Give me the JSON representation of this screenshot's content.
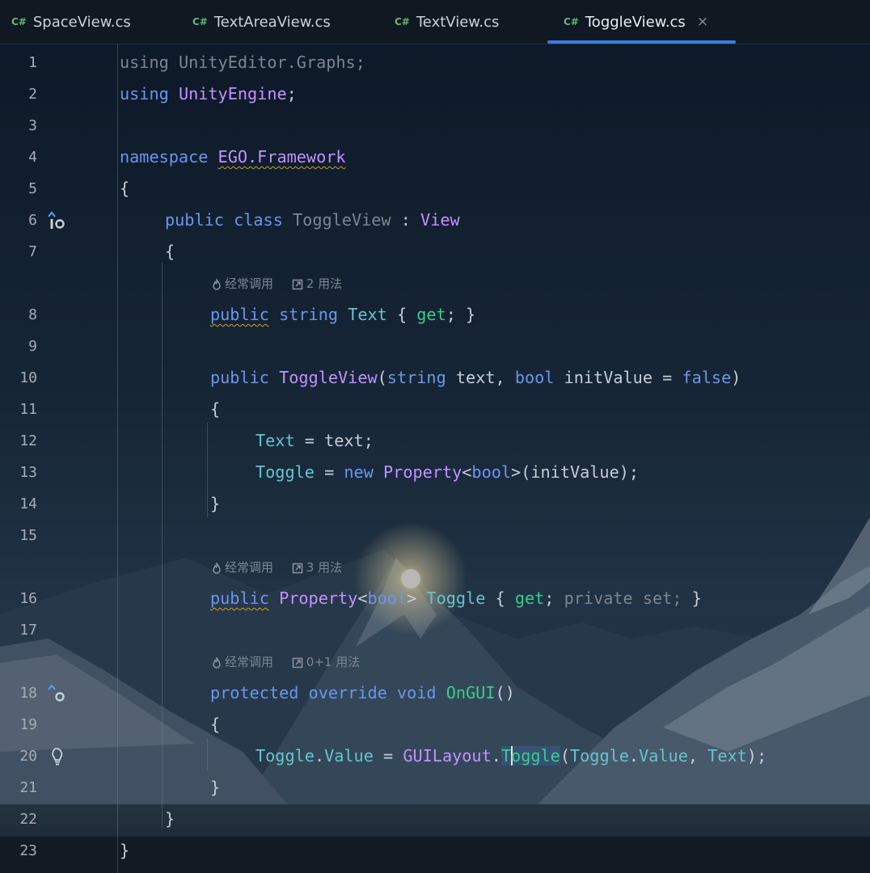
{
  "tabs": [
    {
      "lang": "C#",
      "label": "SpaceView.cs"
    },
    {
      "lang": "C#",
      "label": "TextAreaView.cs"
    },
    {
      "lang": "C#",
      "label": "TextView.cs"
    },
    {
      "lang": "C#",
      "label": "ToggleView.cs",
      "close": "×"
    }
  ],
  "active_tab_index": 3,
  "colors": {
    "keyword": "#6c95eb",
    "type": "#c191ff",
    "property": "#66c3cc",
    "method_accessor": "#39cc8f",
    "dimmed": "#7d858f",
    "accent": "#3b7be6",
    "tab_icon": "#5fb87a"
  },
  "editor": {
    "line_numbers": [
      "1",
      "2",
      "3",
      "4",
      "5",
      "6",
      "7",
      "8",
      "9",
      "10",
      "11",
      "12",
      "13",
      "14",
      "15",
      "16",
      "17",
      "18",
      "19",
      "20",
      "21",
      "22",
      "23"
    ],
    "hints": {
      "h8": {
        "frequent": "经常调用",
        "usages": "2 用法"
      },
      "h16": {
        "frequent": "经常调用",
        "usages": "3 用法"
      },
      "h18": {
        "frequent": "经常调用",
        "usages": "0+1 用法"
      }
    },
    "gutter_icons": {
      "6": "implemented-up-icon",
      "18": "override-up-icon",
      "20": "lightbulb-icon"
    },
    "lines": {
      "l1": {
        "kw": "using",
        "ns": "UnityEditor.Graphs",
        "end": ";"
      },
      "l2": {
        "kw": "using",
        "ns": "UnityEngine",
        "end": ";"
      },
      "l4": {
        "kw": "namespace",
        "ns": "EGO.Framework"
      },
      "l5": {
        "brace": "{"
      },
      "l6": {
        "kw1": "public",
        "kw2": "class",
        "name": "ToggleView",
        "colon": ":",
        "base": "View"
      },
      "l7": {
        "brace": "{"
      },
      "l8": {
        "kw1": "public",
        "kw2": "string",
        "name": "Text",
        "open": "{",
        "acc": "get",
        "end": "; }"
      },
      "l10": {
        "kw": "public",
        "name": "ToggleView",
        "p1": "(",
        "t1": "string",
        "a1": " text, ",
        "t2": "bool",
        "a2": " initValue = ",
        "v": "false",
        "p2": ")"
      },
      "l11": {
        "brace": "{"
      },
      "l12": {
        "prop": "Text",
        "rest": " = text;"
      },
      "l13": {
        "prop": "Toggle",
        "eq": " = ",
        "kw": "new",
        "type": "Property",
        "lt": "<",
        "t": "bool",
        "gt": ">",
        "rest": "(initValue);"
      },
      "l14": {
        "brace": "}"
      },
      "l16": {
        "kw": "public",
        "type": "Property",
        "lt": "<",
        "t": "bool",
        "gt": ">",
        "name": "Toggle",
        "open": "{",
        "acc": "get",
        "semi": ";",
        "dim": "private set;",
        "close": "}"
      },
      "l18": {
        "kw1": "protected",
        "kw2": "override",
        "kw3": "void",
        "fn": "OnGUI",
        "paren": "()"
      },
      "l19": {
        "brace": "{"
      },
      "l20": {
        "p1": "Toggle",
        "d1": ".",
        "p2": "Value",
        "eq": " = ",
        "cls": "GUILayout",
        "dot": ".",
        "fnA": "T",
        "fnB": "oggle",
        "op": "(",
        "p3": "Toggle",
        "d2": ".",
        "p4": "Value",
        "comma": ", ",
        "p5": "Text",
        "end": ");"
      },
      "l21": {
        "brace": "}"
      },
      "l22": {
        "brace": "}"
      },
      "l23": {
        "brace": "}"
      }
    }
  }
}
